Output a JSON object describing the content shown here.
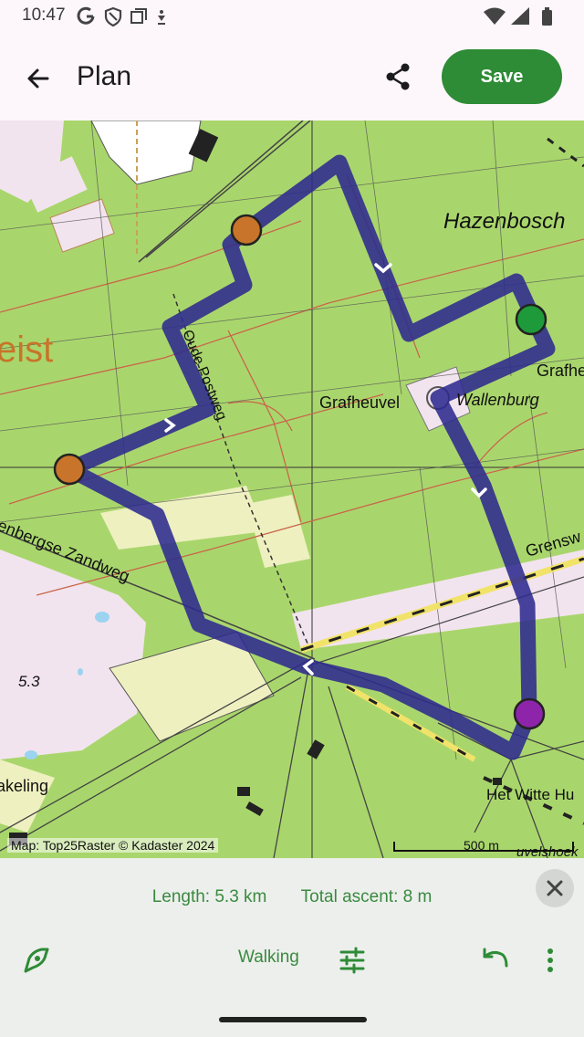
{
  "status_bar": {
    "time": "10:47",
    "left_icons": [
      "google-icon",
      "shield-icon",
      "recent-apps-icon",
      "download-icon"
    ],
    "right_icons": [
      "wifi-icon",
      "signal-icon",
      "battery-icon"
    ]
  },
  "app_bar": {
    "title": "Plan",
    "save_label": "Save",
    "back_icon": "arrow-left-icon",
    "share_icon": "share-icon"
  },
  "map": {
    "labels": {
      "hazenbosch": "Hazenbosch",
      "eist": "eist",
      "grafheuvel": "Grafheuvel",
      "wallenburg": "Wallenburg",
      "grafhe": "Grafhe",
      "oude_postweg": "Oude Postweg",
      "zandweg": "enbergse Zandweg",
      "grensw": "Grensw",
      "elev": "5.3",
      "akeling": "akeling",
      "witte": "Het Witte Hu",
      "uvelshoek": "uvelshoek"
    },
    "attribution": "Map: Top25Raster © Kadaster 2024",
    "scale_label": "500 m",
    "colors": {
      "route": "#2e2a8e",
      "waypoint_orange": "#c8742a",
      "waypoint_green": "#1e9a3a",
      "waypoint_purple": "#8e24aa",
      "forest": "#a9d66c",
      "heath": "#f2e4ee",
      "field": "#eef0c0"
    }
  },
  "panel": {
    "length": "Length: 5.3 km",
    "ascent": "Total ascent: 8 m",
    "mode": "Walking",
    "close_icon": "close-icon",
    "route_icon": "route-icon",
    "settings_icon": "tune-icon",
    "undo_icon": "undo-icon",
    "more_icon": "more-vert-icon"
  }
}
